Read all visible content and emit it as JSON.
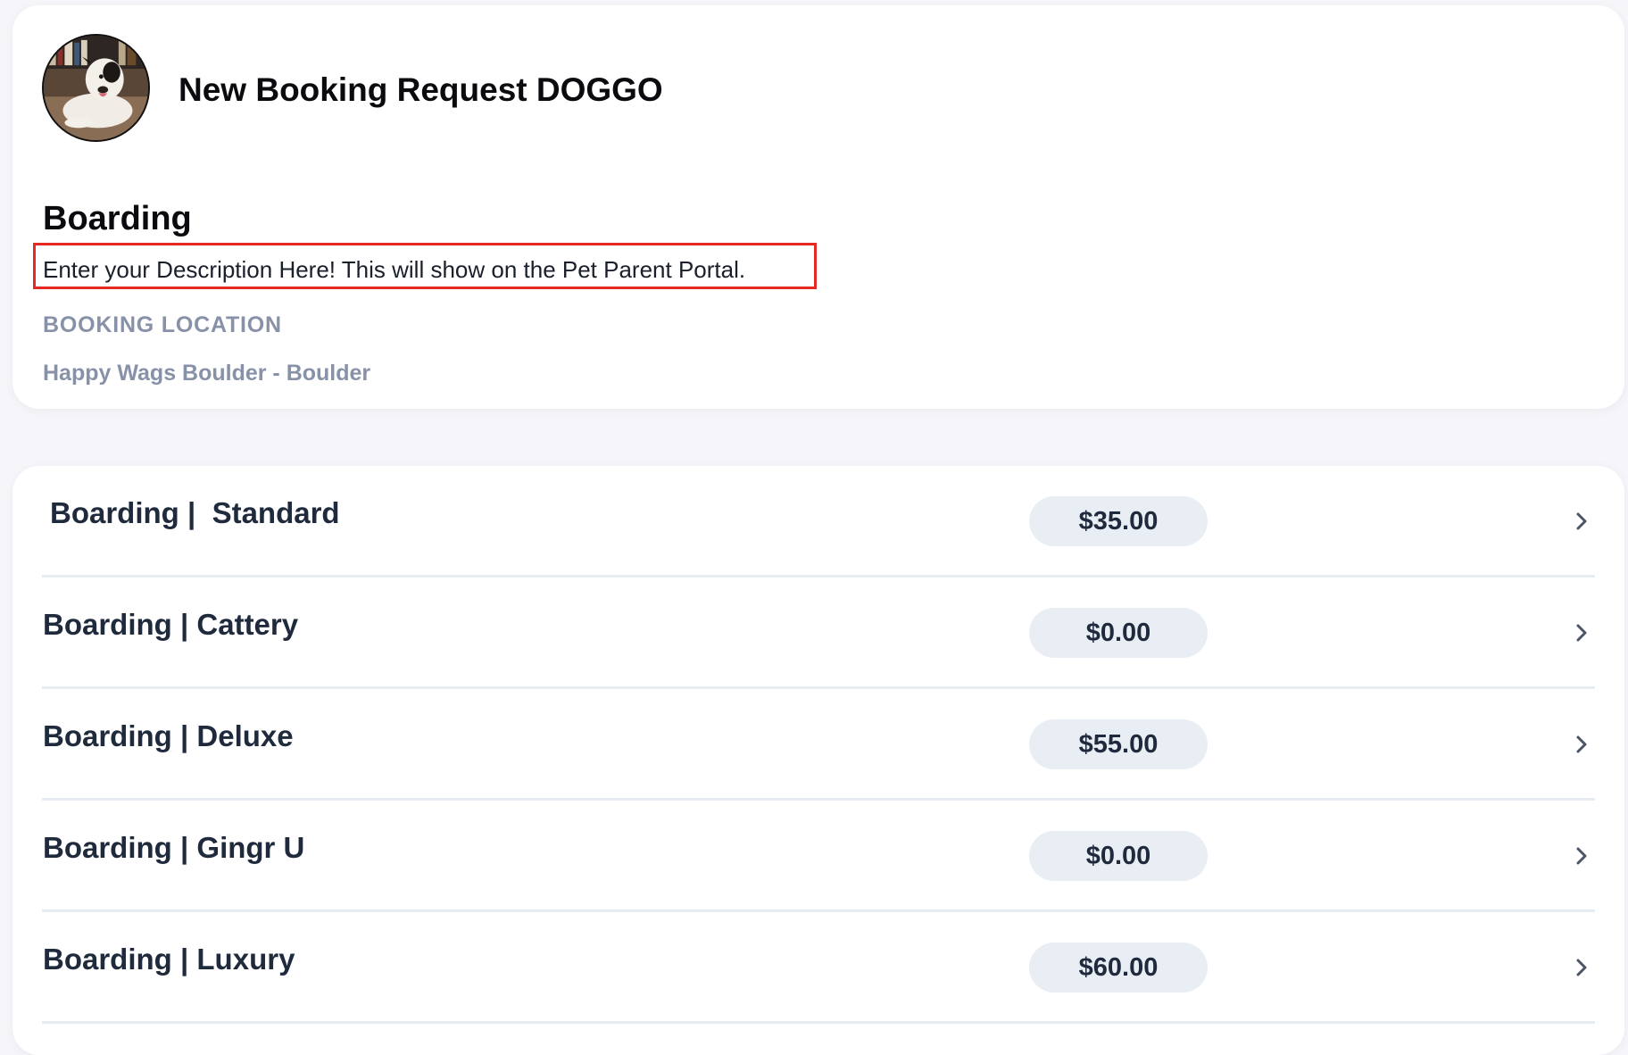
{
  "header": {
    "title": "New Booking Request DOGGO",
    "avatar_icon": "dog-photo-avatar"
  },
  "service": {
    "title": "Boarding",
    "description": "Enter your Description Here! This will show on the Pet Parent Portal.",
    "location_label": "BOOKING LOCATION",
    "location_value": "Happy Wags Boulder - Boulder"
  },
  "options": [
    {
      "label": "Boarding |  Standard",
      "price": "$35.00"
    },
    {
      "label": "Boarding | Cattery",
      "price": "$0.00"
    },
    {
      "label": "Boarding | Deluxe",
      "price": "$55.00"
    },
    {
      "label": "Boarding | Gingr U",
      "price": "$0.00"
    },
    {
      "label": "Boarding | Luxury",
      "price": "$60.00"
    }
  ],
  "colors": {
    "highlight_border": "#e42a22",
    "muted_text": "#8792a8",
    "pill_background": "#e9edf4"
  }
}
